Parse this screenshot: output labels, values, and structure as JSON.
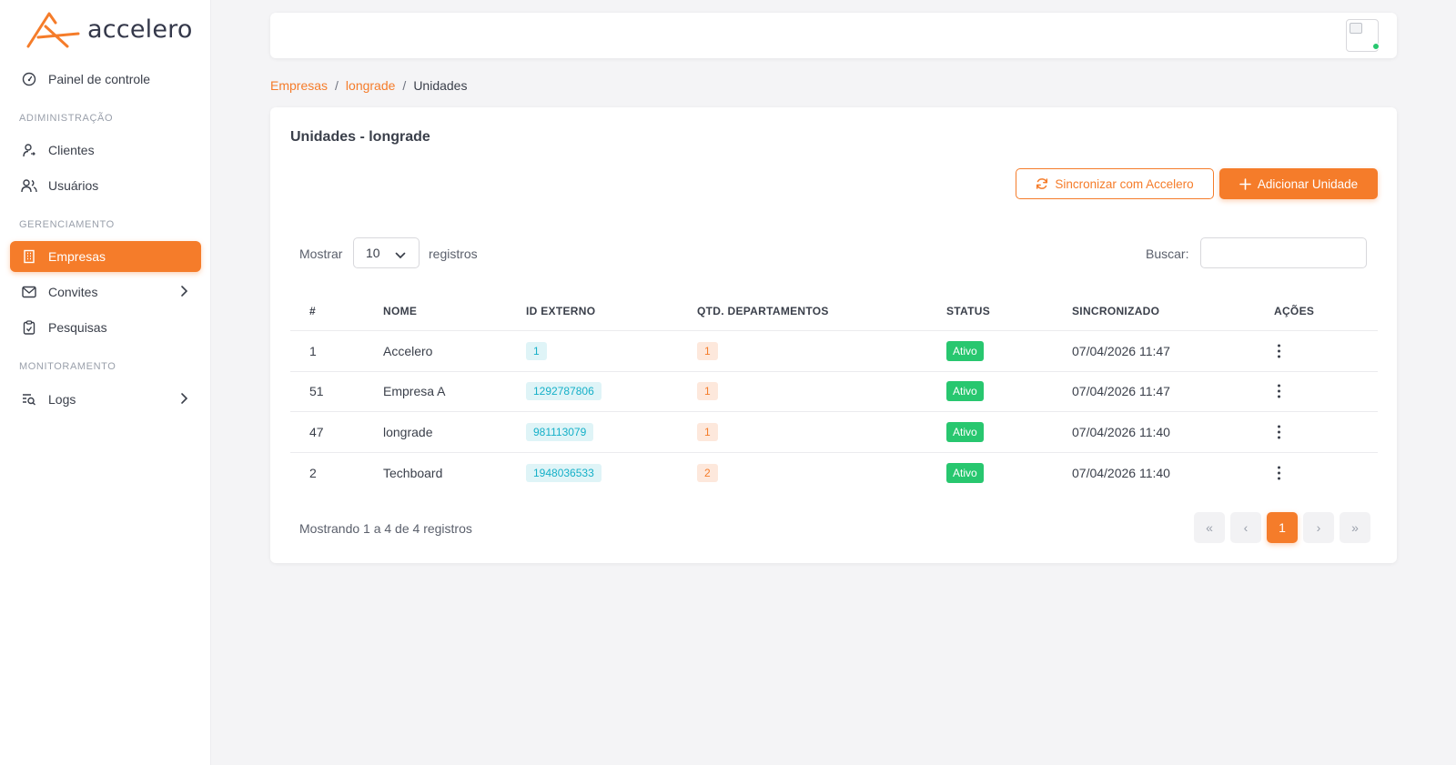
{
  "brand": {
    "name": "accelero",
    "color": "#f57c2a"
  },
  "sidebar": {
    "dashboard": {
      "label": "Painel de controle",
      "icon": "gauge-icon"
    },
    "sections": [
      {
        "title": "ADIMINISTRAÇÃO"
      },
      {
        "title": "GERENCIAMENTO"
      },
      {
        "title": "MONITORAMENTO"
      }
    ],
    "items": [
      {
        "label": "Clientes",
        "icon": "user-icon"
      },
      {
        "label": "Usuários",
        "icon": "users-icon"
      },
      {
        "label": "Empresas",
        "icon": "building-icon",
        "active": true
      },
      {
        "label": "Convites",
        "icon": "mail-icon",
        "has_children": true
      },
      {
        "label": "Pesquisas",
        "icon": "clipboard-check-icon"
      },
      {
        "label": "Logs",
        "icon": "list-search-icon",
        "has_children": true
      }
    ]
  },
  "breadcrumb": [
    "Empresas",
    "longrade",
    "Unidades"
  ],
  "card": {
    "title": "Unidades - longrade",
    "sync_button": "Sincronizar com Accelero",
    "add_button": "Adicionar Unidade",
    "length": {
      "prefix": "Mostrar",
      "value": "10",
      "suffix": "registros"
    },
    "search": {
      "label": "Buscar:",
      "value": "",
      "placeholder": ""
    }
  },
  "table": {
    "columns": [
      "#",
      "NOME",
      "ID EXTERNO",
      "QTD. DEPARTAMENTOS",
      "STATUS",
      "SINCRONIZADO",
      "AÇÕES"
    ],
    "rows": [
      {
        "id": "1",
        "nome": "Accelero",
        "id_externo": "1",
        "qtd": "1",
        "status": "Ativo",
        "sincronizado": "07/04/2026 11:47"
      },
      {
        "id": "51",
        "nome": "Empresa A",
        "id_externo": "1292787806",
        "qtd": "1",
        "status": "Ativo",
        "sincronizado": "07/04/2026 11:47"
      },
      {
        "id": "47",
        "nome": "longrade",
        "id_externo": "981113079",
        "qtd": "1",
        "status": "Ativo",
        "sincronizado": "07/04/2026 11:40"
      },
      {
        "id": "2",
        "nome": "Techboard",
        "id_externo": "1948036533",
        "qtd": "2",
        "status": "Ativo",
        "sincronizado": "07/04/2026 11:40"
      }
    ]
  },
  "footer": {
    "info": "Mostrando 1 a 4 de 4 registros",
    "pagination": {
      "first": "«",
      "prev": "‹",
      "current": "1",
      "next": "›",
      "last": "»"
    }
  },
  "colors": {
    "accent": "#f57c2a",
    "success": "#28c76f",
    "info": "#15b0c8"
  }
}
